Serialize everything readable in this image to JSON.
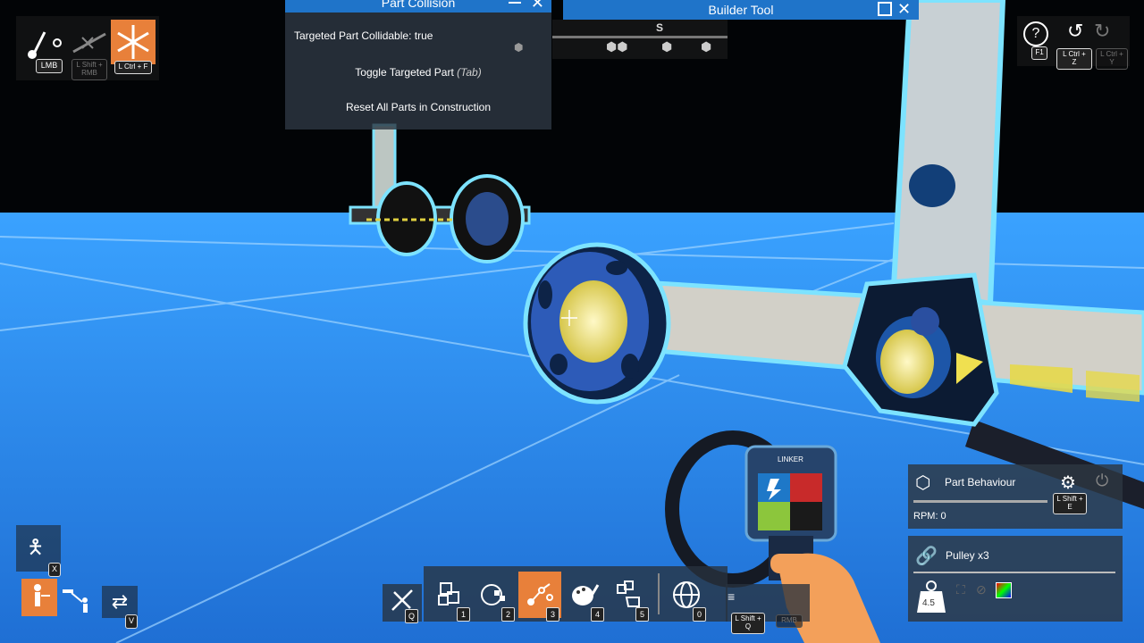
{
  "part_collision": {
    "title": "Part Collision",
    "status": "Targeted Part Collidable: true",
    "toggle_label": "Toggle Targeted Part",
    "toggle_key": "(Tab)",
    "reset_label": "Reset All Parts in Construction"
  },
  "builder_tool": {
    "title": "Builder Tool",
    "col_label": "S"
  },
  "top_left": {
    "lmb_key": "LMB",
    "shift_rmb_key": "L Shift + RMB",
    "ctrl_f_key": "L Ctrl + F"
  },
  "top_right": {
    "help_key": "F1",
    "undo_key": "L Ctrl + Z",
    "redo_key": "L Ctrl + Y"
  },
  "left_bottom": {
    "x_key": "X",
    "v_key": "V"
  },
  "toolbar": {
    "slots": [
      {
        "icon": "wrench-cross-icon",
        "key": "Q"
      },
      {
        "icon": "blocks-icon",
        "key": "1"
      },
      {
        "icon": "sphere-checker-icon",
        "key": "2"
      },
      {
        "icon": "linker-icon",
        "key": "3"
      },
      {
        "icon": "palette-icon",
        "key": "4"
      },
      {
        "icon": "hand-blocks-icon",
        "key": "5"
      },
      {
        "icon": "globe-icon",
        "key": "0"
      }
    ],
    "menu_key": "L Shift + Q",
    "rmb_key": "RMB"
  },
  "part_behaviour": {
    "title": "Part Behaviour",
    "rpm": "RPM: 0",
    "settings_key": "L Shift + E"
  },
  "part_info": {
    "name": "Pulley x3",
    "weight": "4.5"
  },
  "device": {
    "label": "LINKER"
  },
  "colors": {
    "accent_orange": "#e8803a",
    "title_blue": "#1f74c9",
    "floor_blue": "#2a8ff0"
  }
}
